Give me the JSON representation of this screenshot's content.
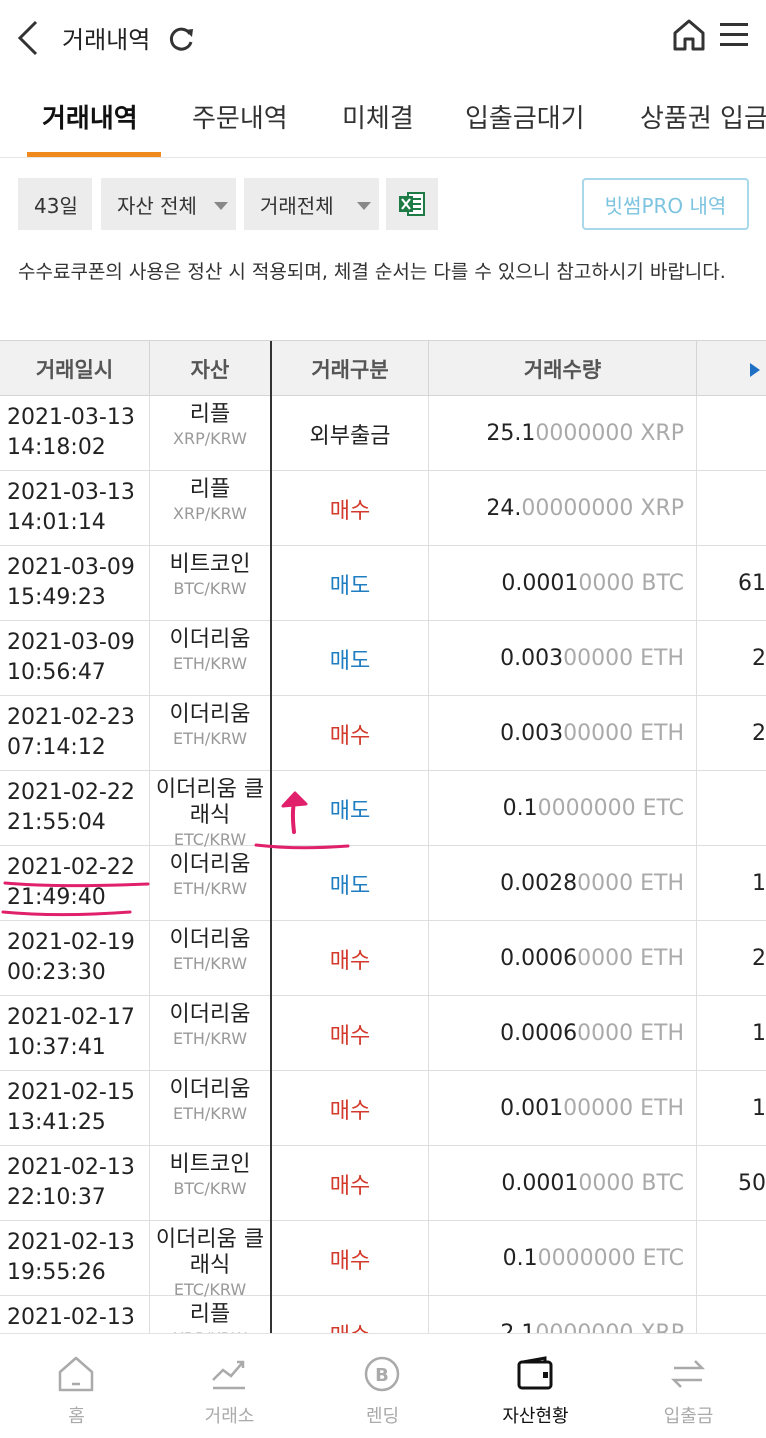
{
  "header": {
    "title": "거래내역"
  },
  "tabs": [
    "거래내역",
    "주문내역",
    "미체결",
    "입출금대기",
    "상품권 입금"
  ],
  "filters": {
    "period": "43일",
    "asset": "자산 전체",
    "trade": "거래전체",
    "pro_button": "빗썸PRO 내역"
  },
  "notice": "수수료쿠폰의 사용은 정산 시 적용되며, 체결 순서는 다를 수 있으니 참고하시기 바랍니다.",
  "table": {
    "headers": [
      "거래일시",
      "자산",
      "거래구분",
      "거래수량"
    ],
    "rows": [
      {
        "date": "2021-03-13",
        "time": "14:18:02",
        "asset": "리플",
        "pair": "XRP/KRW",
        "type": "외부출금",
        "kind": "ext",
        "qty_sig": "25.1",
        "qty_fade": "0000000 XRP",
        "extra": ""
      },
      {
        "date": "2021-03-13",
        "time": "14:01:14",
        "asset": "리플",
        "pair": "XRP/KRW",
        "type": "매수",
        "kind": "buy",
        "qty_sig": "24.",
        "qty_fade": "00000000 XRP",
        "extra": ""
      },
      {
        "date": "2021-03-09",
        "time": "15:49:23",
        "asset": "비트코인",
        "pair": "BTC/KRW",
        "type": "매도",
        "kind": "sell",
        "qty_sig": "0.0001",
        "qty_fade": "0000 BTC",
        "extra": "61"
      },
      {
        "date": "2021-03-09",
        "time": "10:56:47",
        "asset": "이더리움",
        "pair": "ETH/KRW",
        "type": "매도",
        "kind": "sell",
        "qty_sig": "0.003",
        "qty_fade": "00000 ETH",
        "extra": "2"
      },
      {
        "date": "2021-02-23",
        "time": "07:14:12",
        "asset": "이더리움",
        "pair": "ETH/KRW",
        "type": "매수",
        "kind": "buy",
        "qty_sig": "0.003",
        "qty_fade": "00000 ETH",
        "extra": "2"
      },
      {
        "date": "2021-02-22",
        "time": "21:55:04",
        "asset": "이더리움 클래식",
        "pair": "ETC/KRW",
        "type": "매도",
        "kind": "sell",
        "qty_sig": "0.1",
        "qty_fade": "0000000 ETC",
        "extra": ""
      },
      {
        "date": "2021-02-22",
        "time": "21:49:40",
        "asset": "이더리움",
        "pair": "ETH/KRW",
        "type": "매도",
        "kind": "sell",
        "qty_sig": "0.0028",
        "qty_fade": "0000 ETH",
        "extra": "1"
      },
      {
        "date": "2021-02-19",
        "time": "00:23:30",
        "asset": "이더리움",
        "pair": "ETH/KRW",
        "type": "매수",
        "kind": "buy",
        "qty_sig": "0.0006",
        "qty_fade": "0000 ETH",
        "extra": "2"
      },
      {
        "date": "2021-02-17",
        "time": "10:37:41",
        "asset": "이더리움",
        "pair": "ETH/KRW",
        "type": "매수",
        "kind": "buy",
        "qty_sig": "0.0006",
        "qty_fade": "0000 ETH",
        "extra": "1"
      },
      {
        "date": "2021-02-15",
        "time": "13:41:25",
        "asset": "이더리움",
        "pair": "ETH/KRW",
        "type": "매수",
        "kind": "buy",
        "qty_sig": "0.001",
        "qty_fade": "00000 ETH",
        "extra": "1"
      },
      {
        "date": "2021-02-13",
        "time": "22:10:37",
        "asset": "비트코인",
        "pair": "BTC/KRW",
        "type": "매수",
        "kind": "buy",
        "qty_sig": "0.0001",
        "qty_fade": "0000 BTC",
        "extra": "50"
      },
      {
        "date": "2021-02-13",
        "time": "19:55:26",
        "asset": "이더리움 클래식",
        "pair": "ETC/KRW",
        "type": "매수",
        "kind": "buy",
        "qty_sig": "0.1",
        "qty_fade": "0000000 ETC",
        "extra": ""
      },
      {
        "date": "2021-02-13",
        "time": "",
        "asset": "리플",
        "pair": "XRP/KRW",
        "type": "매수",
        "kind": "buy",
        "qty_sig": "2.1",
        "qty_fade": "0000000 XRP",
        "extra": ""
      }
    ]
  },
  "bottom_nav": [
    {
      "label": "홈",
      "icon": "home-icon"
    },
    {
      "label": "거래소",
      "icon": "chart-icon"
    },
    {
      "label": "렌딩",
      "icon": "coin-icon"
    },
    {
      "label": "자산현황",
      "icon": "wallet-icon",
      "active": true
    },
    {
      "label": "입출금",
      "icon": "transfer-icon"
    }
  ],
  "colors": {
    "accent": "#f08a1d",
    "buy": "#d33a2c",
    "sell": "#1f7ec2",
    "annotation": "#e0206a"
  }
}
